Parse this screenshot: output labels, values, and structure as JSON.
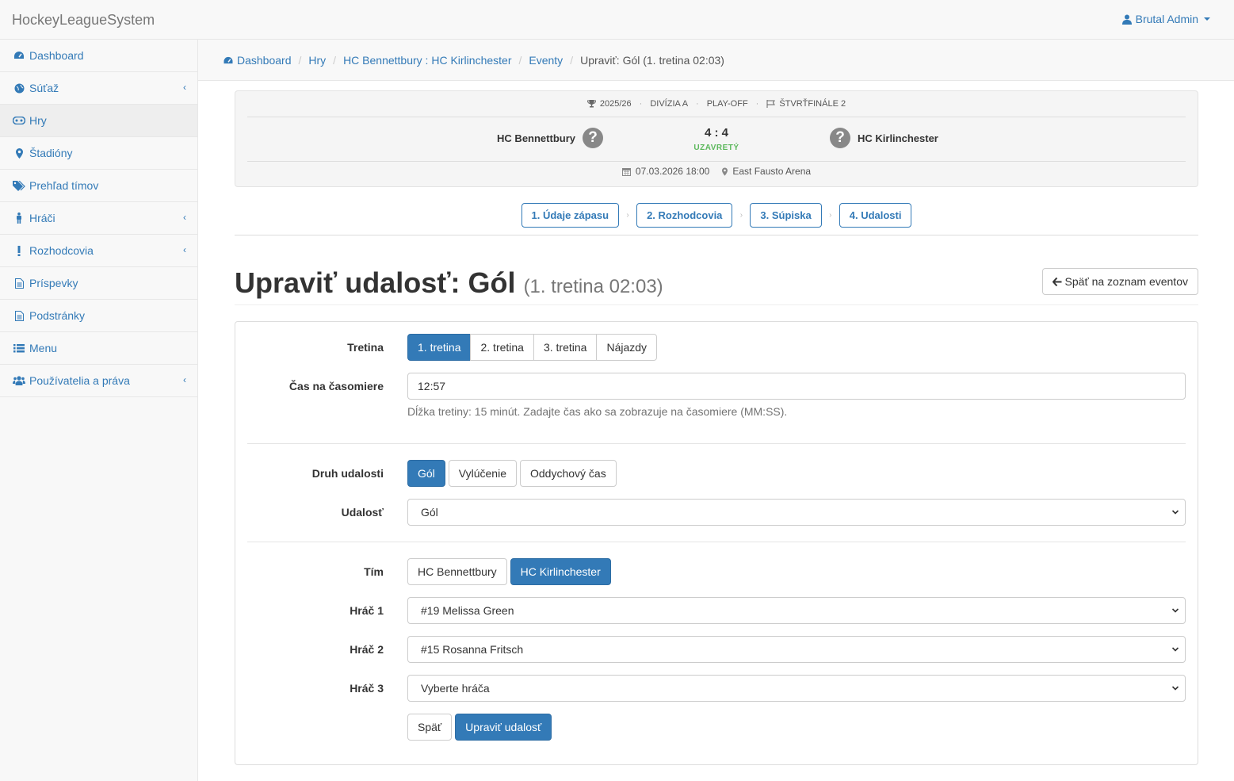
{
  "topbar": {
    "brand": "HockeyLeagueSystem",
    "user": "Brutal Admin"
  },
  "sidebar": {
    "items": [
      {
        "label": "Dashboard",
        "icon": "dashboard-icon"
      },
      {
        "label": "Súťaž",
        "icon": "globe-icon"
      },
      {
        "label": "Hry",
        "icon": "gamepad-icon"
      },
      {
        "label": "Štadióny",
        "icon": "map-marker-icon"
      },
      {
        "label": "Prehľad tímov",
        "icon": "tags-icon"
      },
      {
        "label": "Hráči",
        "icon": "male-icon"
      },
      {
        "label": "Rozhodcovia",
        "icon": "exclamation-icon"
      },
      {
        "label": "Príspevky",
        "icon": "file-text-icon"
      },
      {
        "label": "Podstránky",
        "icon": "file-text-icon"
      },
      {
        "label": "Menu",
        "icon": "list-icon"
      },
      {
        "label": "Používatelia a práva",
        "icon": "users-icon"
      }
    ]
  },
  "breadcrumb": {
    "items": [
      "Dashboard",
      "Hry",
      "HC Bennettbury : HC Kirlinchester",
      "Eventy"
    ],
    "current": "Upraviť: Gól (1. tretina 02:03)"
  },
  "match": {
    "season": "2025/26",
    "division": "DIVÍZIA A",
    "phase": "PLAY-OFF",
    "round": "ŠTVRŤFINÁLE 2",
    "home_team": "HC Bennettbury",
    "away_team": "HC Kirlinchester",
    "score": "4 : 4",
    "status": "UZAVRETÝ",
    "datetime": "07.03.2026 18:00",
    "venue": "East Fausto Arena",
    "logo_placeholder": "?"
  },
  "steps": [
    "1. Údaje zápasu",
    "2. Rozhodcovia",
    "3. Súpiska",
    "4. Udalosti"
  ],
  "page": {
    "title": "Upraviť udalosť: Gól",
    "subtitle": "(1. tretina 02:03)",
    "back_button": "Späť na zoznam eventov"
  },
  "form": {
    "period_label": "Tretina",
    "periods": [
      "1. tretina",
      "2. tretina",
      "3. tretina",
      "Nájazdy"
    ],
    "period_selected": "1. tretina",
    "time_label": "Čas na časomiere",
    "time_value": "12:57",
    "time_help": "Dĺžka tretiny: 15 minút. Zadajte čas ako sa zobrazuje na časomiere (MM:SS).",
    "event_type_label": "Druh udalosti",
    "event_types": [
      "Gól",
      "Vylúčenie",
      "Oddychový čas"
    ],
    "event_type_selected": "Gól",
    "event_label": "Udalosť",
    "event_value": "Gól",
    "team_label": "Tím",
    "teams": [
      "HC Bennettbury",
      "HC Kirlinchester"
    ],
    "team_selected": "HC Kirlinchester",
    "player1_label": "Hráč 1",
    "player1_value": "#19 Melissa Green",
    "player2_label": "Hráč 2",
    "player2_value": "#15 Rosanna Fritsch",
    "player3_label": "Hráč 3",
    "player3_value": "Vyberte hráča",
    "back_label": "Späť",
    "submit_label": "Upraviť udalosť"
  },
  "colors": {
    "primary": "#337ab7",
    "success": "#5cb85c"
  }
}
